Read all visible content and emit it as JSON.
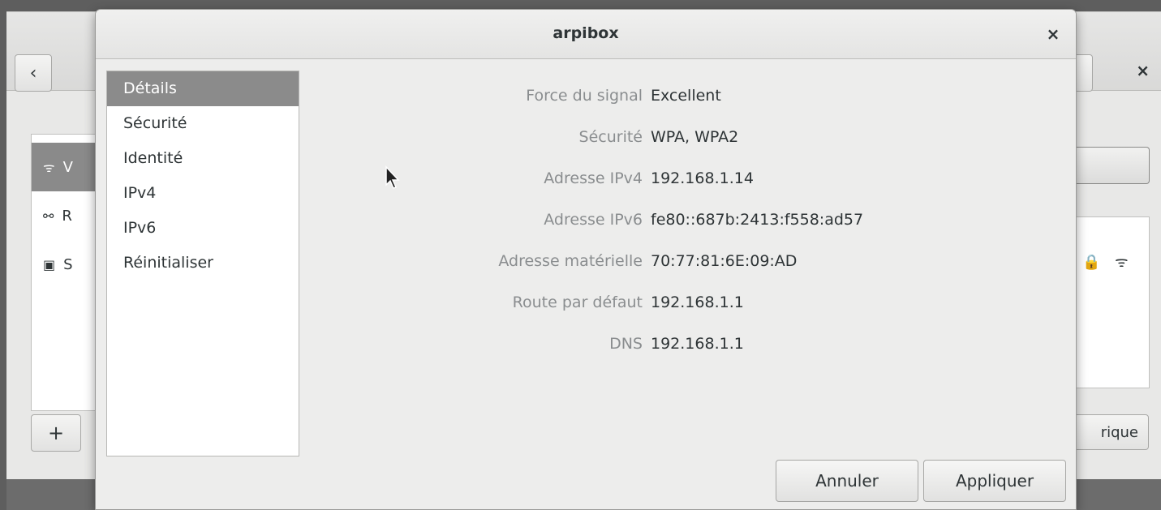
{
  "background_window": {
    "back_icon": "‹",
    "close_icon": "×",
    "add_icon": "+",
    "list_rows": [
      {
        "icon": "wifi-icon",
        "glyph": "ᯤ",
        "label": "V"
      },
      {
        "icon": "wired-network-icon",
        "glyph": "⚯",
        "label": "R"
      },
      {
        "icon": "vpn-icon",
        "glyph": "▣",
        "label": "S"
      }
    ],
    "right_icons": "🔒 ᯤ",
    "right_button_label": "rique"
  },
  "dialog": {
    "title": "arpibox",
    "close_icon": "×",
    "sidebar": [
      {
        "label": "Détails",
        "selected": true
      },
      {
        "label": "Sécurité",
        "selected": false
      },
      {
        "label": "Identité",
        "selected": false
      },
      {
        "label": "IPv4",
        "selected": false
      },
      {
        "label": "IPv6",
        "selected": false
      },
      {
        "label": "Réinitialiser",
        "selected": false
      }
    ],
    "details": [
      {
        "label": "Force du signal",
        "value": "Excellent"
      },
      {
        "label": "Sécurité",
        "value": "WPA, WPA2"
      },
      {
        "label": "Adresse IPv4",
        "value": "192.168.1.14"
      },
      {
        "label": "Adresse IPv6",
        "value": "fe80::687b:2413:f558:ad57"
      },
      {
        "label": "Adresse matérielle",
        "value": "70:77:81:6E:09:AD"
      },
      {
        "label": "Route par défaut",
        "value": "192.168.1.1"
      },
      {
        "label": "DNS",
        "value": "192.168.1.1"
      }
    ],
    "buttons": {
      "cancel": "Annuler",
      "apply": "Appliquer"
    }
  },
  "colors": {
    "selected_bg": "#8b8b8b",
    "label_text": "#8a8d8f",
    "value_text": "#2e3436"
  }
}
